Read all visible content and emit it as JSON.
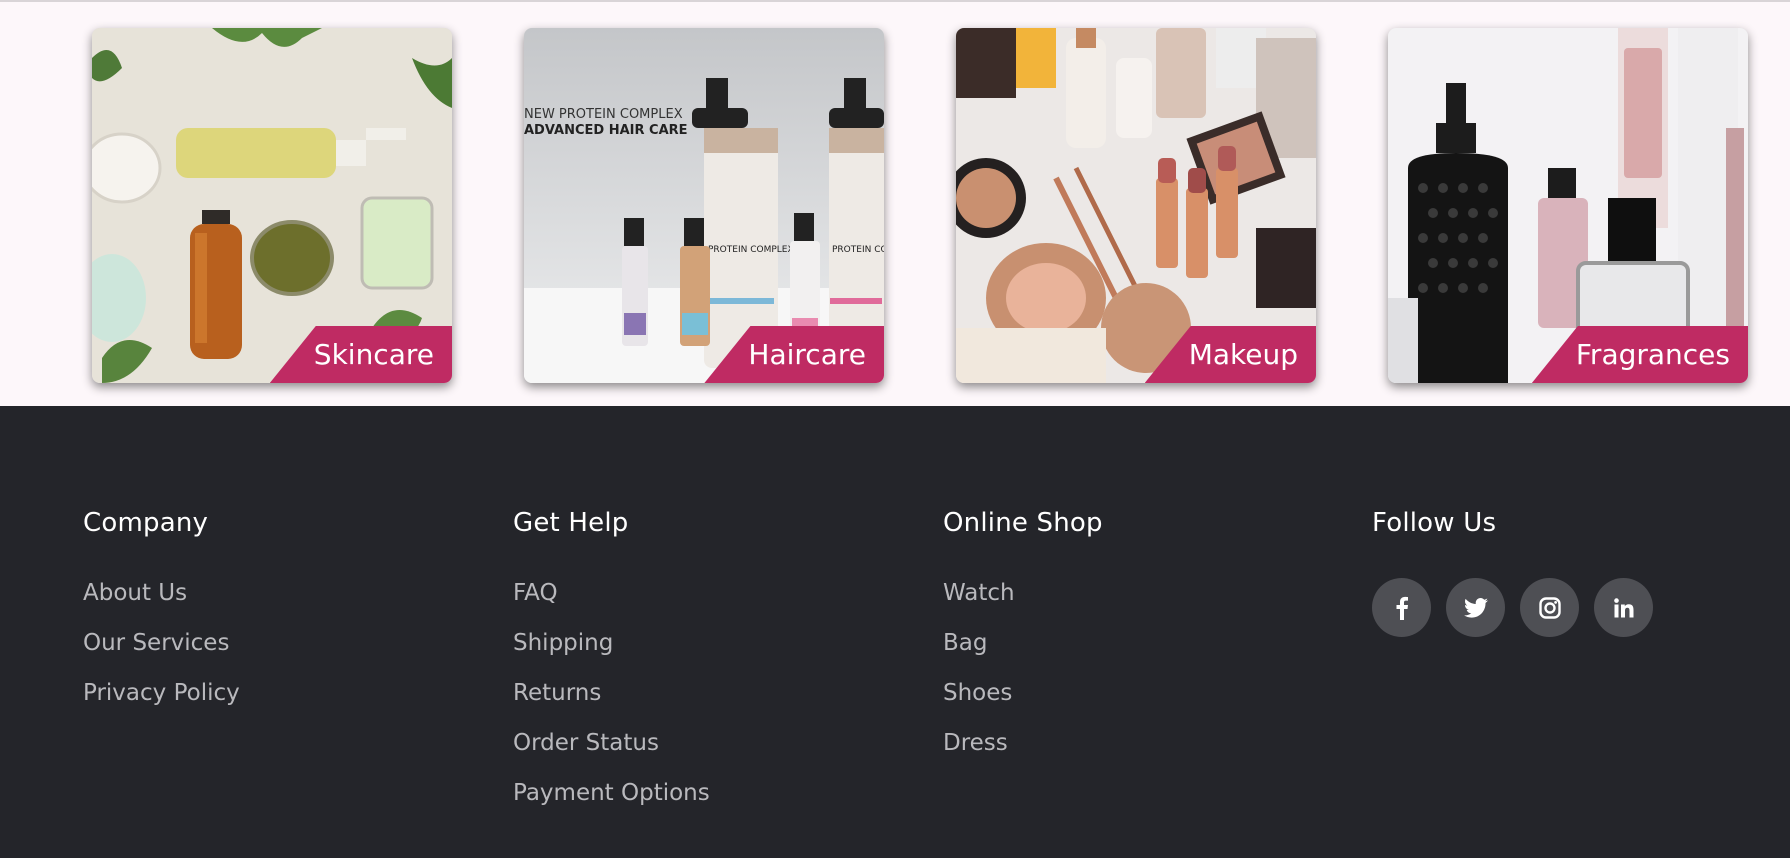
{
  "categories": [
    {
      "label": "Skincare"
    },
    {
      "label": "Haircare"
    },
    {
      "label": "Makeup"
    },
    {
      "label": "Fragrances"
    }
  ],
  "haircare_image_text": {
    "line1": "NEW PROTEIN COMPLEX",
    "line2": "ADVANCED HAIR CARE",
    "bottle_label": "PROTEIN COMPLEX"
  },
  "footer": {
    "columns": [
      {
        "title": "Company",
        "links": [
          "About Us",
          "Our Services",
          "Privacy Policy"
        ]
      },
      {
        "title": "Get Help",
        "links": [
          "FAQ",
          "Shipping",
          "Returns",
          "Order Status",
          "Payment Options"
        ]
      },
      {
        "title": "Online Shop",
        "links": [
          "Watch",
          "Bag",
          "Shoes",
          "Dress"
        ]
      },
      {
        "title": "Follow Us",
        "social": [
          {
            "icon": "facebook-icon"
          },
          {
            "icon": "twitter-icon"
          },
          {
            "icon": "instagram-icon"
          },
          {
            "icon": "linkedin-icon"
          }
        ]
      }
    ]
  },
  "colors": {
    "accent": "#bf2b63",
    "footer_bg": "#24252a",
    "social_bg": "#4e4f54",
    "link_text": "#b9b9bd",
    "page_bg": "#fdf7fa"
  }
}
